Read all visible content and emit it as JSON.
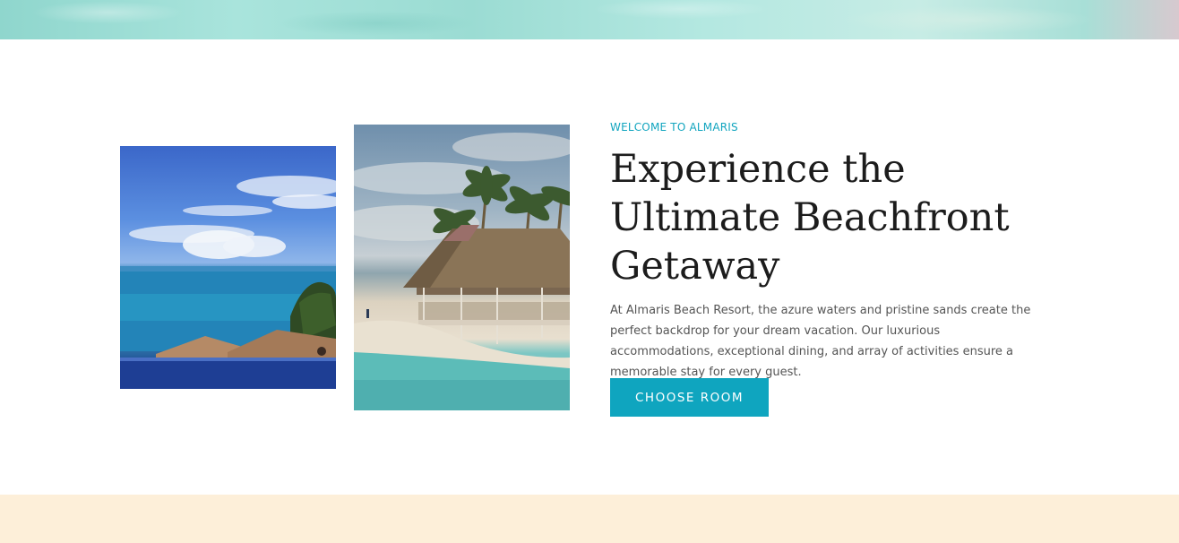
{
  "intro": {
    "eyebrow": "WELCOME TO ALMARIS",
    "headline": "Experience the Ultimate Beachfront Getaway",
    "body": "At Almaris Beach Resort, the azure waters and pristine sands create the perfect backdrop for your dream vacation. Our luxurious accommodations, exceptional dining, and array of activities ensure a memorable stay for every guest.",
    "cta_label": "CHOOSE ROOM"
  },
  "colors": {
    "accent": "#0fa5bf",
    "heading": "#1c1c1c",
    "body_text": "#555555",
    "bottom_band": "#fdefd9",
    "top_band": "#a9e4dc"
  }
}
